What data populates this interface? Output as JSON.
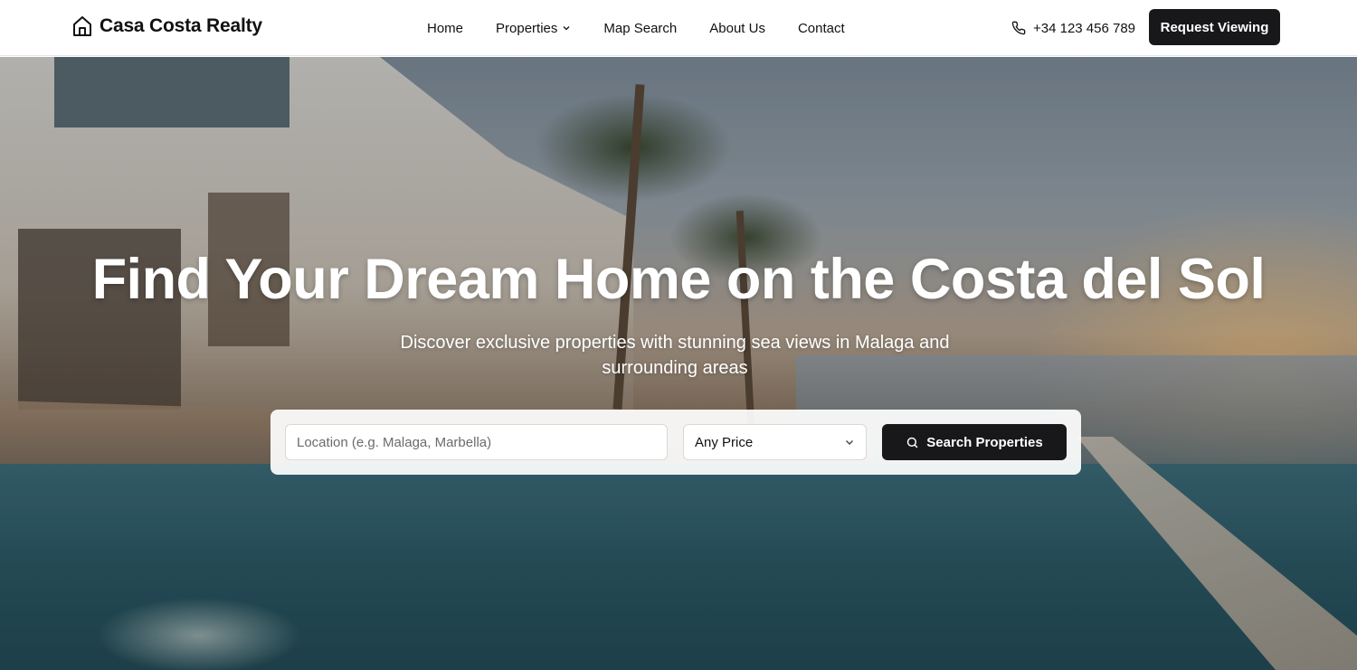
{
  "brand": {
    "name": "Casa Costa Realty",
    "icon": "home-icon"
  },
  "nav": {
    "items": [
      {
        "label": "Home"
      },
      {
        "label": "Properties",
        "has_dropdown": true
      },
      {
        "label": "Map Search"
      },
      {
        "label": "About Us"
      },
      {
        "label": "Contact"
      }
    ]
  },
  "contact": {
    "phone": "+34 123 456 789",
    "icon": "phone-icon"
  },
  "header": {
    "cta_label": "Request Viewing"
  },
  "hero": {
    "title": "Find Your Dream Home on the Costa del Sol",
    "subtitle": "Discover exclusive properties with stunning sea views in Malaga and surrounding areas"
  },
  "search": {
    "location_placeholder": "Location (e.g. Malaga, Marbella)",
    "location_value": "",
    "price_selected": "Any Price",
    "button_label": "Search Properties"
  },
  "colors": {
    "primary_button": "#18181b",
    "text": "#111111",
    "white": "#ffffff"
  }
}
